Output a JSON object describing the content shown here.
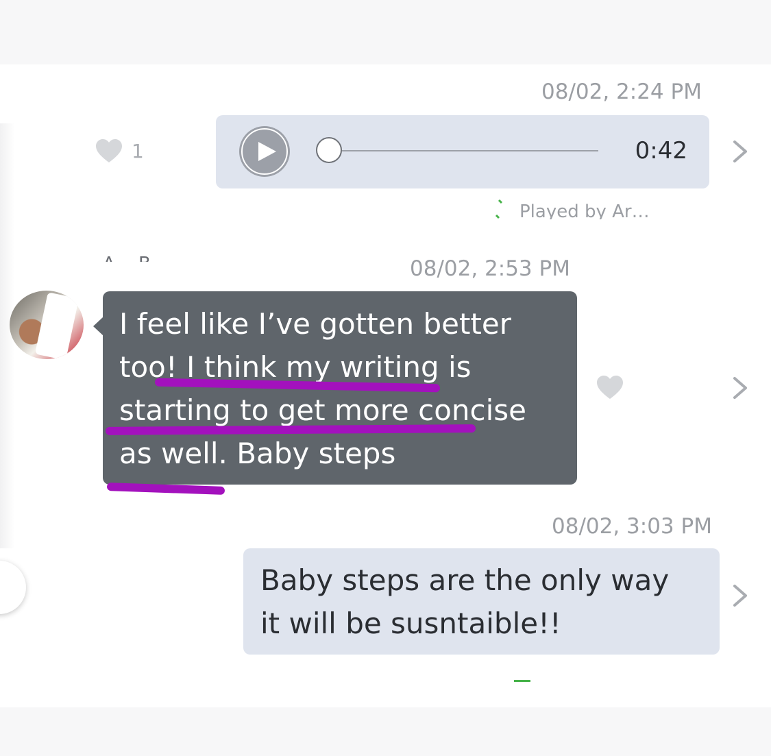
{
  "messages": [
    {
      "timestamp": "08/02, 2:24 PM",
      "type": "audio",
      "likes": "1",
      "duration": "0:42",
      "progress": 0,
      "status": "Played by Ar…"
    },
    {
      "timestamp": "08/02, 2:53 PM",
      "type": "text",
      "sender": "A…  B…",
      "text_lines": [
        "I feel like I’ve gotten better",
        "too! I think my writing is",
        "starting to get more concise",
        "as well. Baby steps"
      ]
    },
    {
      "timestamp": "08/02, 3:03 PM",
      "type": "text",
      "text_lines": [
        "Baby steps are the only way",
        "it will be susntaible!!"
      ]
    }
  ],
  "icons": {
    "like": "heart-icon",
    "play": "play-icon",
    "forward": "chevron-right-icon"
  },
  "colors": {
    "outgoing_bubble": "#dfe4ee",
    "incoming_bubble": "#5f656b",
    "highlight": "#a311bd",
    "timestamp": "#9b9ea3",
    "receipt": "#47b34a"
  }
}
